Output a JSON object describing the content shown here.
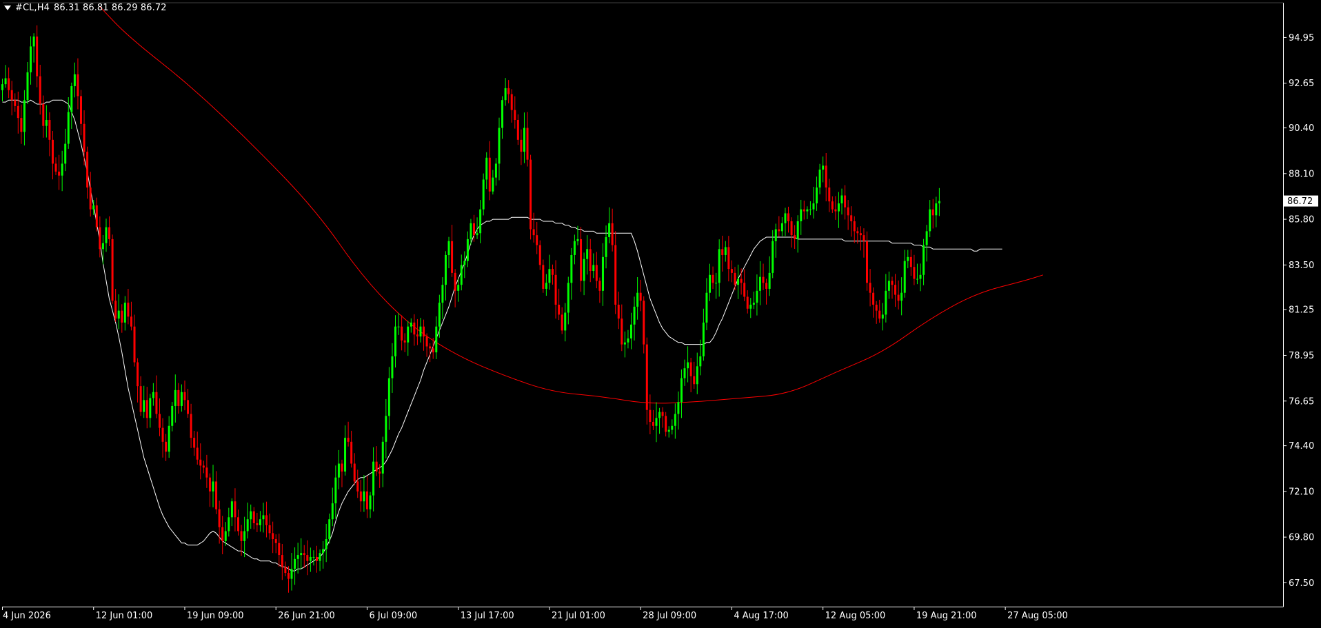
{
  "header": {
    "symbol": "#CL,H4",
    "quote": "86.31 86.81 86.29 86.72"
  },
  "colors": {
    "background": "#000000",
    "axis": "#ffffff",
    "bull": "#00ff00",
    "bear": "#ff0000",
    "ma_fast": "#ffffff",
    "ma_slow": "#ff0000",
    "last_price_bg": "#ffffff",
    "last_price_fg": "#000000"
  },
  "chart_data": {
    "type": "candlestick",
    "title": "#CL,H4",
    "ylim": [
      66.3,
      96.7
    ],
    "y_ticks": [
      67.5,
      69.8,
      72.1,
      74.4,
      76.65,
      78.95,
      81.25,
      83.5,
      85.8,
      88.1,
      90.4,
      92.65,
      94.95
    ],
    "last_price": 86.72,
    "last_price_label": "86.72",
    "x_labels": [
      "4 Jun 2026",
      "12 Jun 01:00",
      "19 Jun 09:00",
      "26 Jun 21:00",
      "6 Jul 09:00",
      "13 Jul 17:00",
      "21 Jul 01:00",
      "28 Jul 09:00",
      "4 Aug 17:00",
      "12 Aug 05:00",
      "19 Aug 21:00",
      "27 Aug 05:00"
    ],
    "x_label_bar_index": [
      0,
      29,
      58,
      87,
      116,
      145,
      174,
      203,
      232,
      261,
      290,
      319
    ],
    "grid": false,
    "close": [
      92.6,
      92.9,
      92.3,
      91.8,
      91.5,
      90.9,
      90.2,
      91.8,
      93.2,
      94.5,
      95.0,
      93.0,
      91.6,
      90.5,
      90.8,
      89.8,
      88.6,
      88.2,
      88.0,
      88.6,
      89.6,
      91.2,
      92.5,
      93.1,
      92.0,
      90.6,
      89.2,
      87.4,
      86.3,
      86.5,
      85.4,
      84.3,
      84.6,
      85.4,
      84.8,
      81.7,
      80.8,
      81.2,
      80.6,
      81.6,
      80.9,
      80.4,
      78.6,
      77.4,
      76.1,
      76.7,
      75.8,
      76.8,
      77.1,
      76.0,
      75.3,
      74.6,
      74.1,
      75.4,
      76.4,
      77.2,
      76.4,
      77.1,
      76.7,
      76.0,
      74.8,
      74.3,
      73.7,
      73.4,
      73.3,
      72.8,
      72.1,
      72.6,
      71.2,
      70.3,
      69.6,
      70.1,
      70.8,
      71.6,
      70.8,
      70.1,
      69.6,
      70.1,
      70.7,
      71.1,
      70.5,
      70.4,
      70.7,
      70.9,
      70.4,
      70.0,
      69.7,
      69.5,
      68.9,
      68.3,
      68.0,
      67.7,
      68.2,
      68.7,
      68.9,
      69.0,
      68.9,
      68.6,
      68.8,
      68.8,
      68.6,
      69.0,
      69.2,
      69.7,
      70.7,
      71.5,
      72.8,
      73.5,
      73.1,
      74.8,
      74.6,
      73.5,
      72.6,
      72.1,
      71.6,
      72.1,
      71.2,
      71.9,
      73.6,
      73.1,
      73.0,
      74.6,
      75.9,
      77.8,
      78.9,
      80.4,
      80.4,
      79.7,
      79.6,
      80.4,
      80.6,
      80.0,
      79.9,
      80.4,
      79.9,
      79.4,
      79.3,
      79.1,
      80.4,
      81.6,
      82.5,
      84.0,
      84.7,
      83.1,
      82.2,
      82.5,
      83.5,
      83.7,
      84.8,
      85.6,
      85.0,
      85.1,
      86.3,
      87.8,
      88.9,
      87.2,
      87.9,
      88.6,
      90.4,
      91.8,
      92.4,
      92.1,
      91.3,
      90.8,
      89.8,
      89.2,
      90.4,
      88.8,
      85.3,
      85.0,
      84.5,
      83.5,
      82.3,
      82.6,
      83.3,
      83.0,
      81.5,
      81.0,
      80.2,
      81.1,
      82.6,
      84.0,
      84.7,
      84.8,
      82.7,
      83.8,
      84.3,
      83.2,
      83.5,
      82.7,
      82.2,
      83.9,
      84.9,
      85.6,
      84.5,
      81.5,
      80.8,
      79.5,
      79.6,
      79.8,
      80.5,
      81.4,
      82.1,
      81.7,
      79.5,
      76.2,
      75.6,
      75.4,
      75.8,
      76.1,
      75.9,
      75.1,
      75.2,
      75.4,
      76.0,
      76.6,
      77.8,
      78.3,
      78.6,
      77.9,
      77.5,
      78.4,
      78.9,
      80.6,
      82.1,
      83.0,
      82.6,
      82.6,
      84.3,
      84.0,
      84.4,
      83.3,
      83.1,
      82.5,
      82.8,
      82.6,
      81.9,
      81.3,
      81.5,
      81.6,
      82.2,
      82.9,
      82.6,
      82.3,
      83.1,
      84.7,
      85.3,
      85.2,
      85.6,
      86.1,
      85.7,
      85.0,
      84.8,
      85.7,
      86.3,
      86.2,
      86.3,
      86.3,
      86.6,
      87.4,
      88.3,
      88.5,
      87.4,
      86.7,
      86.3,
      86.2,
      86.6,
      87.0,
      86.4,
      86.0,
      85.7,
      85.2,
      85.1,
      85.0,
      84.7,
      82.6,
      82.1,
      81.5,
      81.2,
      80.8,
      81.0,
      82.2,
      82.7,
      82.5,
      82.0,
      81.7,
      82.1,
      83.7,
      83.9,
      83.4,
      82.8,
      82.8,
      83.0,
      84.5,
      85.2,
      86.3,
      86.0,
      86.6,
      86.72
    ],
    "ma_fast": [
      91.7,
      91.7,
      91.8,
      91.8,
      91.8,
      91.8,
      91.7,
      91.7,
      91.7,
      91.8,
      91.7,
      91.6,
      91.6,
      91.6,
      91.7,
      91.7,
      91.8,
      91.8,
      91.8,
      91.8,
      91.7,
      91.6,
      91.2,
      90.8,
      90.2,
      89.6,
      88.9,
      88.2,
      87.3,
      86.5,
      85.6,
      84.7,
      83.6,
      82.7,
      81.8,
      81.2,
      80.6,
      79.9,
      79.1,
      78.2,
      77.3,
      76.6,
      75.9,
      75.2,
      74.5,
      73.8,
      73.3,
      72.8,
      72.3,
      71.8,
      71.3,
      70.9,
      70.6,
      70.3,
      70.1,
      69.9,
      69.7,
      69.5,
      69.5,
      69.4,
      69.4,
      69.4,
      69.4,
      69.5,
      69.6,
      69.8,
      70.0,
      70.1,
      70.0,
      69.8,
      69.6,
      69.5,
      69.4,
      69.3,
      69.2,
      69.1,
      69.1,
      69.0,
      68.9,
      68.8,
      68.7,
      68.7,
      68.6,
      68.6,
      68.6,
      68.6,
      68.5,
      68.5,
      68.4,
      68.3,
      68.3,
      68.2,
      68.1,
      68.1,
      68.2,
      68.2,
      68.3,
      68.4,
      68.5,
      68.6,
      68.7,
      68.8,
      69.0,
      69.3,
      69.6,
      70.0,
      70.6,
      71.1,
      71.5,
      71.8,
      72.1,
      72.3,
      72.5,
      72.7,
      72.8,
      72.8,
      72.9,
      73.0,
      73.1,
      73.2,
      73.3,
      73.4,
      73.6,
      73.9,
      74.2,
      74.6,
      75.0,
      75.3,
      75.7,
      76.1,
      76.5,
      76.9,
      77.3,
      77.7,
      78.2,
      78.6,
      79.0,
      79.4,
      79.8,
      80.2,
      80.6,
      81.0,
      81.4,
      81.9,
      82.4,
      82.8,
      83.2,
      83.6,
      84.1,
      84.6,
      85.0,
      85.3,
      85.5,
      85.6,
      85.7,
      85.7,
      85.8,
      85.8,
      85.8,
      85.8,
      85.8,
      85.8,
      85.9,
      85.9,
      85.9,
      85.9,
      85.9,
      85.9,
      85.8,
      85.8,
      85.8,
      85.8,
      85.7,
      85.7,
      85.7,
      85.7,
      85.6,
      85.6,
      85.6,
      85.5,
      85.5,
      85.4,
      85.4,
      85.3,
      85.3,
      85.2,
      85.2,
      85.2,
      85.2,
      85.1,
      85.1,
      85.1,
      85.1,
      85.1,
      85.1,
      85.1,
      85.1,
      85.1,
      85.1,
      85.1,
      85.1,
      84.7,
      84.2,
      83.6,
      83.0,
      82.4,
      81.8,
      81.4,
      81.0,
      80.6,
      80.3,
      80.1,
      79.9,
      79.8,
      79.7,
      79.6,
      79.6,
      79.5,
      79.5,
      79.5,
      79.5,
      79.5,
      79.5,
      79.5,
      79.6,
      79.6,
      79.8,
      80.1,
      80.5,
      80.8,
      81.2,
      81.6,
      82.0,
      82.4,
      82.8,
      83.1,
      83.4,
      83.7,
      84.0,
      84.3,
      84.5,
      84.7,
      84.8,
      84.9,
      84.9,
      84.9,
      84.9,
      84.9,
      84.9,
      84.9,
      84.9,
      84.9,
      84.9,
      84.8,
      84.8,
      84.8,
      84.8,
      84.8,
      84.8,
      84.8,
      84.8,
      84.8,
      84.8,
      84.8,
      84.8,
      84.8,
      84.8,
      84.8,
      84.7,
      84.7,
      84.7,
      84.7,
      84.7,
      84.7,
      84.7,
      84.7,
      84.7,
      84.7,
      84.7,
      84.7,
      84.7,
      84.7,
      84.7,
      84.6,
      84.6,
      84.6,
      84.6,
      84.6,
      84.6,
      84.6,
      84.5,
      84.5,
      84.5,
      84.4,
      84.4,
      84.4,
      84.3,
      84.3,
      84.3,
      84.3,
      84.3,
      84.3,
      84.3,
      84.3,
      84.3,
      84.3,
      84.3,
      84.3,
      84.3,
      84.2,
      84.2,
      84.3,
      84.3,
      84.3,
      84.3,
      84.3,
      84.3,
      84.3,
      84.3
    ],
    "ma_slow_anchors": [
      [
        31,
        96.5
      ],
      [
        40,
        95.0
      ],
      [
        60,
        92.5
      ],
      [
        80,
        89.5
      ],
      [
        100,
        86.2
      ],
      [
        115,
        82.8
      ],
      [
        130,
        80.4
      ],
      [
        145,
        78.9
      ],
      [
        160,
        77.9
      ],
      [
        175,
        77.1
      ],
      [
        190,
        76.9
      ],
      [
        205,
        76.5
      ],
      [
        220,
        76.6
      ],
      [
        235,
        76.8
      ],
      [
        250,
        77.0
      ],
      [
        265,
        78.1
      ],
      [
        280,
        79.1
      ],
      [
        295,
        80.8
      ],
      [
        310,
        82.1
      ],
      [
        325,
        82.7
      ],
      [
        331,
        83.0
      ]
    ]
  }
}
